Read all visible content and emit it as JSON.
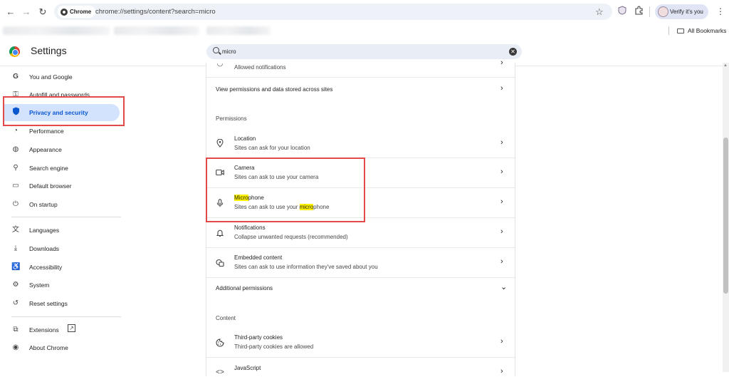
{
  "toolbar": {
    "back": "←",
    "forward": "→",
    "reload": "↻",
    "chip_label": "Chrome",
    "url": "chrome://settings/content?search=micro",
    "star": "☆",
    "verify_label": "Verify it's you",
    "kebab": "⋮"
  },
  "bookmarks": {
    "all_bookmarks": "All Bookmarks"
  },
  "header": {
    "title": "Settings",
    "search_value": "micro",
    "clear": "✕"
  },
  "sidebar": {
    "items": [
      {
        "label": "You and Google",
        "icon": "G"
      },
      {
        "label": "Autofill and passwords",
        "icon": "⚿"
      },
      {
        "label": "Privacy and security",
        "icon": "⛉"
      },
      {
        "label": "Performance",
        "icon": "◔"
      },
      {
        "label": "Appearance",
        "icon": "◍"
      },
      {
        "label": "Search engine",
        "icon": "⚲"
      },
      {
        "label": "Default browser",
        "icon": "▭"
      },
      {
        "label": "On startup",
        "icon": "⏻"
      },
      {
        "label": "Languages",
        "icon": "文"
      },
      {
        "label": "Downloads",
        "icon": "⤓"
      },
      {
        "label": "Accessibility",
        "icon": "♿"
      },
      {
        "label": "System",
        "icon": "⚙"
      },
      {
        "label": "Reset settings",
        "icon": "↺"
      },
      {
        "label": "Extensions",
        "icon": "⧉",
        "ext": "↗"
      },
      {
        "label": "About Chrome",
        "icon": "◉"
      }
    ]
  },
  "content": {
    "partial_row": "Allowed notifications",
    "view_permissions": "View permissions and data stored across sites",
    "permissions_heading": "Permissions",
    "location": {
      "title": "Location",
      "desc": "Sites can ask for your location"
    },
    "camera": {
      "title": "Camera",
      "desc": "Sites can ask to use your camera"
    },
    "microphone": {
      "title_hl": "Micro",
      "title_rest": "phone",
      "desc_pre": "Sites can ask to use your ",
      "desc_hl": "micro",
      "desc_post": "phone"
    },
    "notifications": {
      "title": "Notifications",
      "desc": "Collapse unwanted requests (recommended)"
    },
    "embedded": {
      "title": "Embedded content",
      "desc": "Sites can ask to use information they've saved about you"
    },
    "additional_permissions": "Additional permissions",
    "content_heading": "Content",
    "cookies": {
      "title": "Third-party cookies",
      "desc": "Third-party cookies are allowed"
    },
    "javascript": {
      "title": "JavaScript"
    },
    "chevron": "›",
    "expand": "⌄"
  },
  "colors": {
    "accent": "#0b57d0",
    "active_bg": "#d3e3fd",
    "highlight": "#fff200",
    "annotation_red": "#e24a4a"
  }
}
